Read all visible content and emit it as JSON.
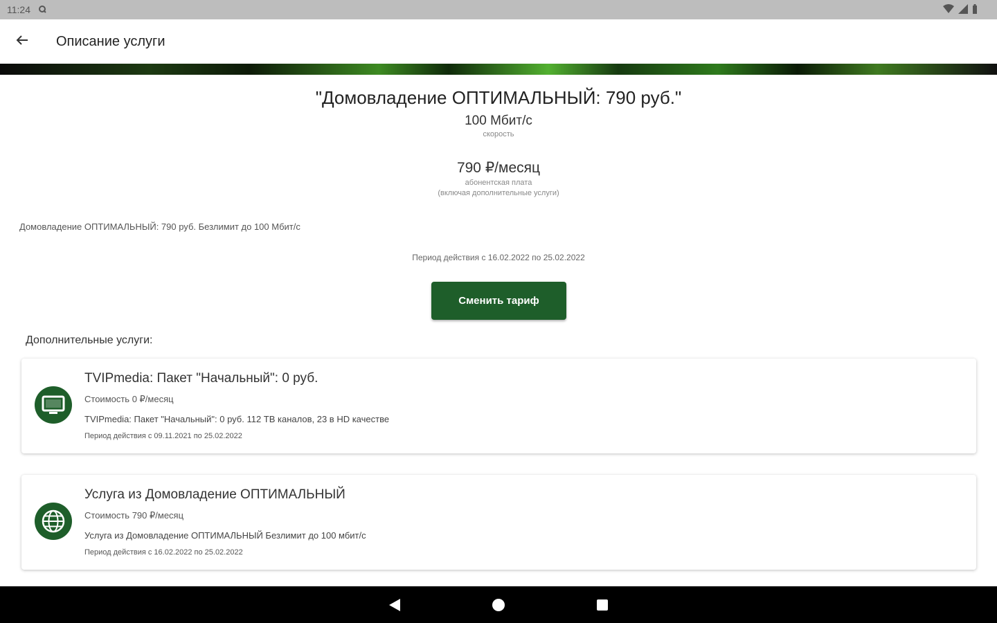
{
  "status_bar": {
    "time": "11:24"
  },
  "app_bar": {
    "title": "Описание услуги"
  },
  "tariff": {
    "title": "\"Домовладение ОПТИМАЛЬНЫЙ: 790 руб.\"",
    "speed_value": "100 Мбит/с",
    "speed_label": "скорость",
    "price_value": "790 ₽/месяц",
    "price_label_1": "абонентская плата",
    "price_label_2": "(включая дополнительные услуги)",
    "description": "Домовладение ОПТИМАЛЬНЫЙ: 790 руб. Безлимит до 100 Мбит/с",
    "period": "Период действия с 16.02.2022 по 25.02.2022",
    "change_button": "Сменить тариф"
  },
  "extra_services": {
    "heading": "Дополнительные услуги:",
    "items": [
      {
        "icon": "tv-icon",
        "title": "TVIPmedia: Пакет \"Начальный\": 0 руб.",
        "cost": "Стоимость 0 ₽/месяц",
        "description": "TVIPmedia: Пакет \"Начальный\": 0 руб. 112 ТВ каналов, 23 в HD качестве",
        "period": "Период действия с 09.11.2021 по 25.02.2022"
      },
      {
        "icon": "globe-icon",
        "title": "Услуга из Домовладение ОПТИМАЛЬНЫЙ",
        "cost": "Стоимость 790 ₽/месяц",
        "description": "Услуга из Домовладение ОПТИМАЛЬНЫЙ Безлимит до 100 мбит/с",
        "period": "Период действия с 16.02.2022 по 25.02.2022"
      }
    ]
  },
  "colors": {
    "primary_green": "#1e5e2a",
    "status_bar": "#bdbdbd",
    "nav_bar": "#000000"
  }
}
